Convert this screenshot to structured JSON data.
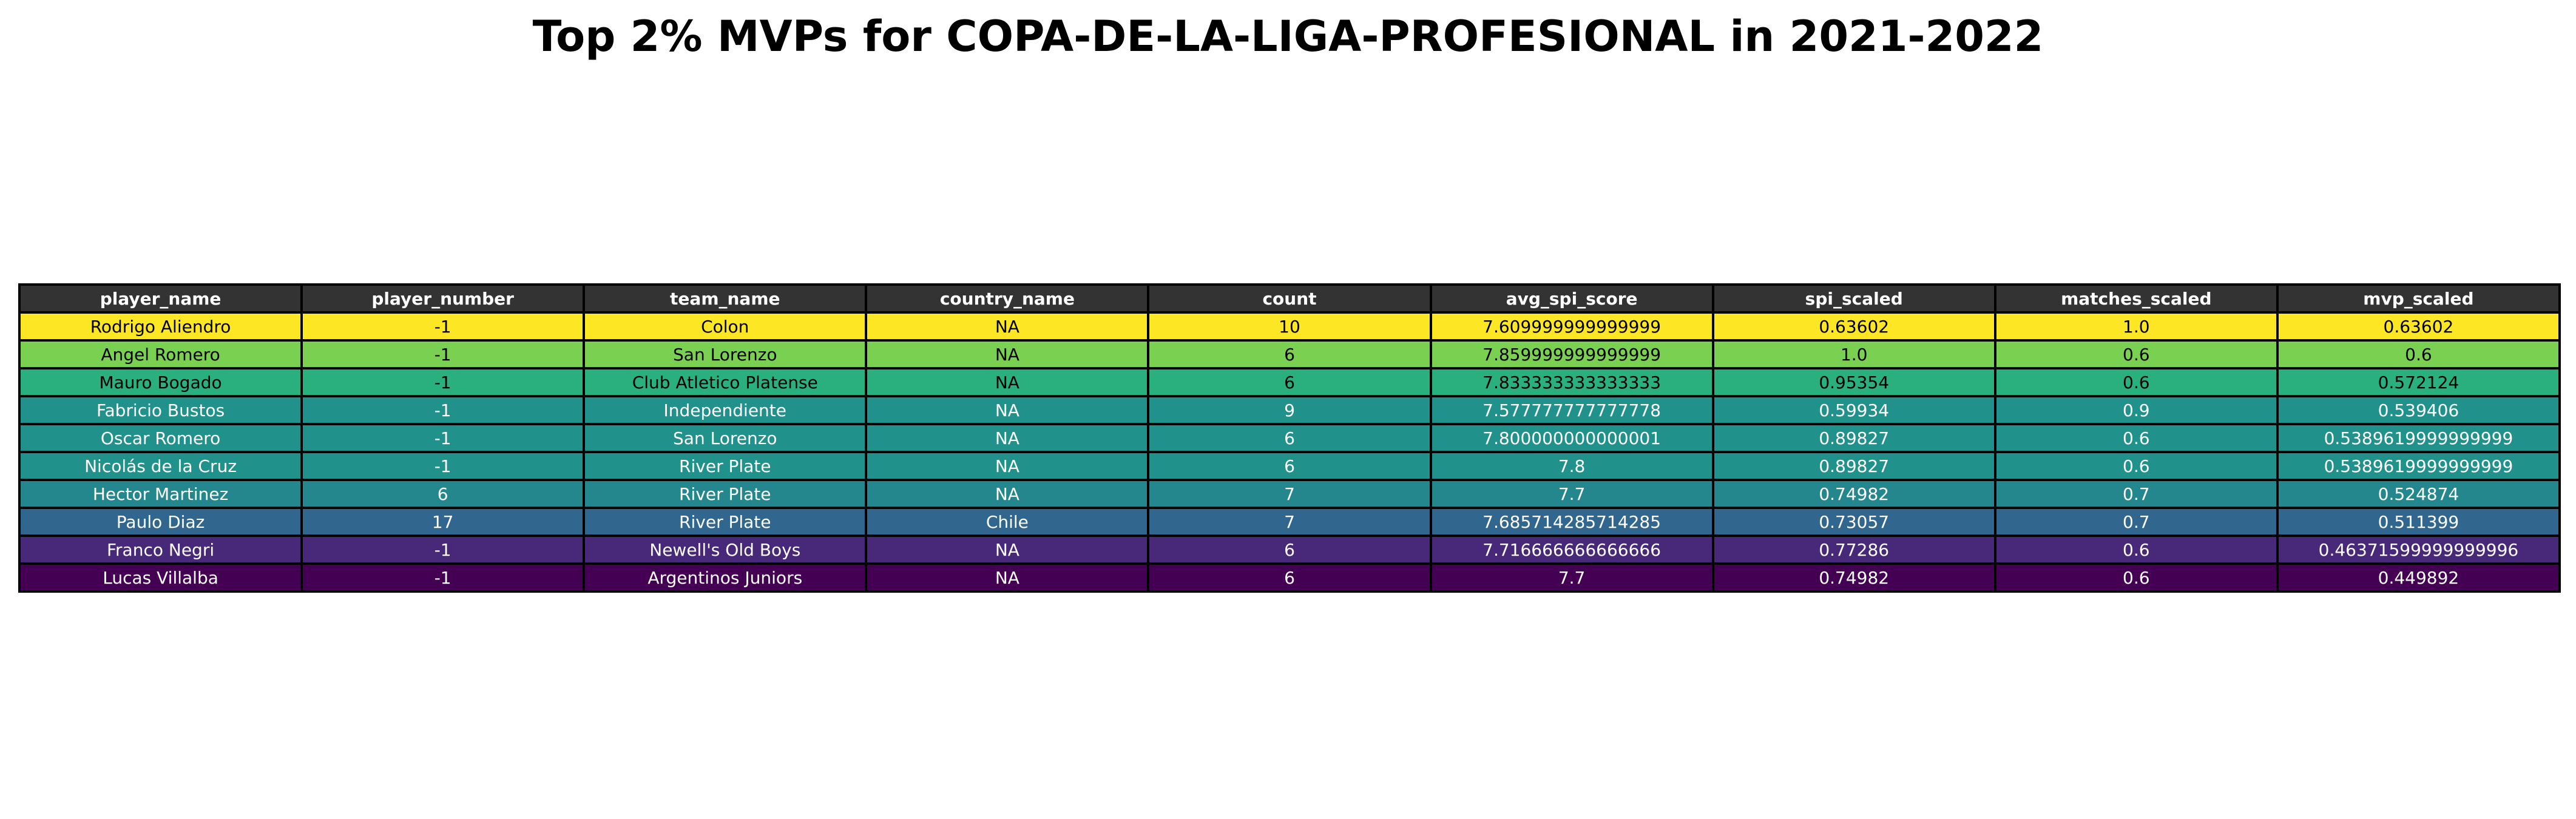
{
  "chart_data": {
    "type": "table",
    "title": "Top 2% MVPs for COPA-DE-LA-LIGA-PROFESIONAL in 2021-2022",
    "columns": [
      "player_name",
      "player_number",
      "team_name",
      "country_name",
      "count",
      "avg_spi_score",
      "spi_scaled",
      "matches_scaled",
      "mvp_scaled"
    ],
    "header_color": "#333333",
    "header_text_color": "#ffffff",
    "rows": [
      {
        "cells": [
          "Rodrigo Aliendro",
          "-1",
          "Colon",
          "NA",
          "10",
          "7.609999999999999",
          "0.63602",
          "1.0",
          "0.63602"
        ],
        "color": "#fde725",
        "text_color": "#000000"
      },
      {
        "cells": [
          "Angel Romero",
          "-1",
          "San Lorenzo",
          "NA",
          "6",
          "7.859999999999999",
          "1.0",
          "0.6",
          "0.6"
        ],
        "color": "#7ad151",
        "text_color": "#000000"
      },
      {
        "cells": [
          "Mauro Bogado",
          "-1",
          "Club Atletico Platense",
          "NA",
          "6",
          "7.833333333333333",
          "0.95354",
          "0.6",
          "0.572124"
        ],
        "color": "#2ab07f",
        "text_color": "#000000"
      },
      {
        "cells": [
          "Fabricio Bustos",
          "-1",
          "Independiente",
          "NA",
          "9",
          "7.577777777777778",
          "0.59934",
          "0.9",
          "0.539406"
        ],
        "color": "#21918c",
        "text_color": "#ffffff"
      },
      {
        "cells": [
          "Oscar Romero",
          "-1",
          "San Lorenzo",
          "NA",
          "6",
          "7.800000000000001",
          "0.89827",
          "0.6",
          "0.5389619999999999"
        ],
        "color": "#21918c",
        "text_color": "#ffffff"
      },
      {
        "cells": [
          "Nicolás de la Cruz",
          "-1",
          "River Plate",
          "NA",
          "6",
          "7.8",
          "0.89827",
          "0.6",
          "0.5389619999999999"
        ],
        "color": "#21918c",
        "text_color": "#ffffff"
      },
      {
        "cells": [
          "Hector Martinez",
          "6",
          "River Plate",
          "NA",
          "7",
          "7.7",
          "0.74982",
          "0.7",
          "0.524874"
        ],
        "color": "#24878e",
        "text_color": "#ffffff"
      },
      {
        "cells": [
          "Paulo Diaz",
          "17",
          "River Plate",
          "Chile",
          "7",
          "7.685714285714285",
          "0.73057",
          "0.7",
          "0.511399"
        ],
        "color": "#31668e",
        "text_color": "#ffffff"
      },
      {
        "cells": [
          "Franco Negri",
          "-1",
          "Newell's Old Boys",
          "NA",
          "6",
          "7.716666666666666",
          "0.77286",
          "0.6",
          "0.46371599999999996"
        ],
        "color": "#482979",
        "text_color": "#ffffff"
      },
      {
        "cells": [
          "Lucas Villalba",
          "-1",
          "Argentinos Juniors",
          "NA",
          "6",
          "7.7",
          "0.74982",
          "0.6",
          "0.449892"
        ],
        "color": "#440154",
        "text_color": "#ffffff"
      }
    ]
  }
}
